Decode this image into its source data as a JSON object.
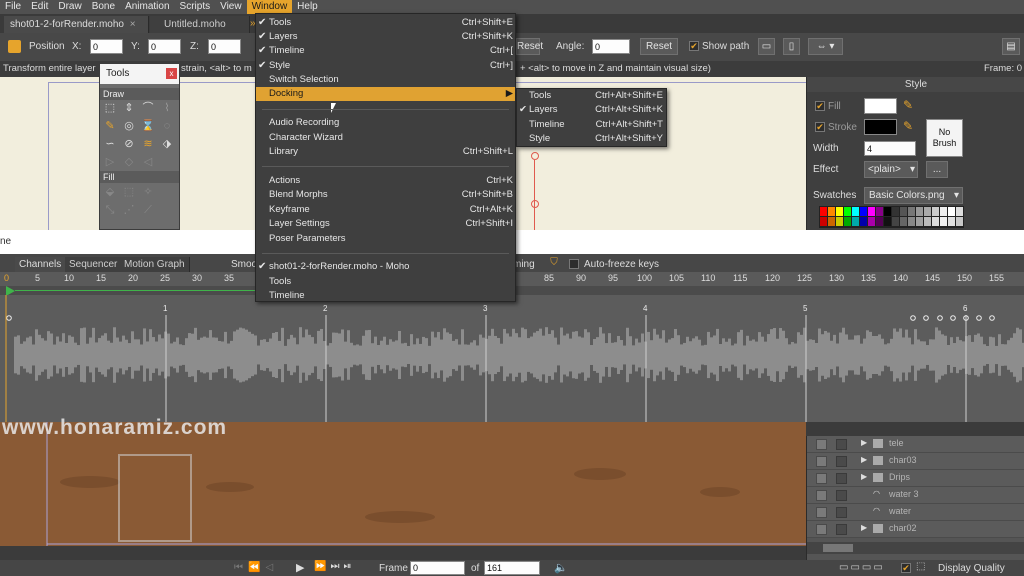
{
  "menubar": {
    "items": [
      "File",
      "Edit",
      "Draw",
      "Bone",
      "Animation",
      "Scripts",
      "View",
      "Window",
      "Help"
    ],
    "active": "Window"
  },
  "tabs": [
    {
      "label": "shot01-2-forRender.moho"
    },
    {
      "label": "Untitled.moho"
    }
  ],
  "options": {
    "position_label": "Position",
    "x_label": "X:",
    "x_value": "0",
    "y_label": "Y:",
    "y_value": "0",
    "z_label": "Z:",
    "z_value": "0",
    "reset_label": "Reset",
    "angle_label": "Angle:",
    "angle_value": "0",
    "reset2_label": "Reset",
    "show_path_label": "Show path"
  },
  "status": {
    "left_text": "Transform entire layer",
    "mid_text": "strain, <alt> to m",
    "right_text": "+ <alt> to move in Z and maintain visual size)",
    "frame_text": "Frame: 0"
  },
  "tools_window": {
    "title": "Tools",
    "close": "x",
    "draw_section": "Draw",
    "fill_section": "Fill"
  },
  "style_panel": {
    "title": "Style",
    "fill_label": "Fill",
    "stroke_label": "Stroke",
    "no_brush_line1": "No",
    "no_brush_line2": "Brush",
    "width_label": "Width",
    "width_value": "4",
    "effect_label": "Effect",
    "effect_value": "<plain>",
    "more_label": "...",
    "swatches_label": "Swatches",
    "swatches_value": "Basic Colors.png",
    "fill_color": "#ffffff",
    "stroke_color": "#000000"
  },
  "white_strip_text": "ne",
  "timeline": {
    "tabs": [
      "Channels",
      "Sequencer",
      "Motion Graph"
    ],
    "smooth_label": "Smoo",
    "timing_label": "ming",
    "autofreeze_label": "Auto-freeze keys",
    "ruler_ticks": [
      "0",
      "5",
      "10",
      "15",
      "20",
      "25",
      "30",
      "35",
      "85",
      "90",
      "95",
      "100",
      "105",
      "110",
      "115",
      "120",
      "125",
      "130",
      "135",
      "140",
      "145",
      "150",
      "155"
    ],
    "second_marks": [
      "1",
      "2",
      "3",
      "4",
      "5",
      "6"
    ]
  },
  "watermark": "www.honaramiz.com",
  "layers": [
    {
      "name": "tele"
    },
    {
      "name": "char03"
    },
    {
      "name": "Drips"
    },
    {
      "name": "water 3"
    },
    {
      "name": "water"
    },
    {
      "name": "char02"
    }
  ],
  "playback": {
    "frame_label": "Frame",
    "frame_value": "0",
    "of_label": "of",
    "total_value": "161",
    "display_quality": "Display Quality"
  },
  "window_menu": {
    "items": [
      {
        "label": "Tools",
        "shortcut": "Ctrl+Shift+E",
        "checked": "✔"
      },
      {
        "label": "Layers",
        "shortcut": "Ctrl+Shift+K",
        "checked": "✔"
      },
      {
        "label": "Timeline",
        "shortcut": "Ctrl+[",
        "checked": "✔"
      },
      {
        "label": "Style",
        "shortcut": "Ctrl+]",
        "checked": "✔"
      },
      {
        "label": "Switch Selection",
        "shortcut": "",
        "checked": ""
      },
      {
        "label": "Docking",
        "shortcut": "▶",
        "checked": ""
      },
      {
        "label": "Audio Recording",
        "shortcut": "",
        "checked": ""
      },
      {
        "label": "Character Wizard",
        "shortcut": "",
        "checked": ""
      },
      {
        "label": "Library",
        "shortcut": "Ctrl+Shift+L",
        "checked": ""
      },
      {
        "label": "Actions",
        "shortcut": "Ctrl+K",
        "checked": ""
      },
      {
        "label": "Blend Morphs",
        "shortcut": "Ctrl+Shift+B",
        "checked": ""
      },
      {
        "label": "Keyframe",
        "shortcut": "Ctrl+Alt+K",
        "checked": ""
      },
      {
        "label": "Layer Settings",
        "shortcut": "Ctrl+Shift+I",
        "checked": ""
      },
      {
        "label": "Poser Parameters",
        "shortcut": "",
        "checked": ""
      },
      {
        "label": "shot01-2-forRender.moho - Moho",
        "shortcut": "",
        "checked": "✔"
      },
      {
        "label": "Tools",
        "shortcut": "",
        "checked": ""
      },
      {
        "label": "Timeline",
        "shortcut": "",
        "checked": ""
      }
    ],
    "highlighted": "Docking"
  },
  "docking_submenu": {
    "items": [
      {
        "label": "Tools",
        "shortcut": "Ctrl+Alt+Shift+E",
        "checked": ""
      },
      {
        "label": "Layers",
        "shortcut": "Ctrl+Alt+Shift+K",
        "checked": "✔"
      },
      {
        "label": "Timeline",
        "shortcut": "Ctrl+Alt+Shift+T",
        "checked": ""
      },
      {
        "label": "Style",
        "shortcut": "Ctrl+Alt+Shift+Y",
        "checked": ""
      }
    ]
  },
  "colors": {
    "accent": "#e6a42c",
    "canvas": "#f2eedd",
    "scene_ground": "#8a5a35"
  }
}
